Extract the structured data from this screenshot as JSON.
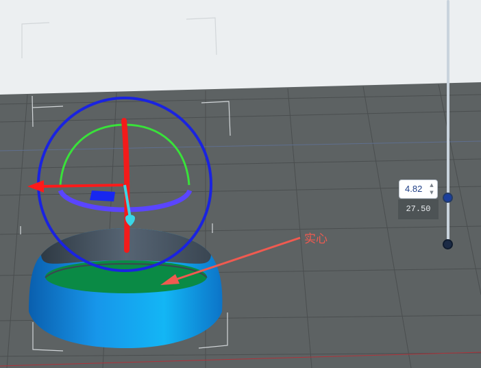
{
  "colors": {
    "background_top": "#eceff1",
    "floor": "#5d6263",
    "grid_line": "#4a4e4f",
    "blue_grid_line": "#5f6f8f",
    "red_axis_line": "#b0323a",
    "gizmo_ring": "#1a23e0",
    "rotate_y_arc": "#39e23a",
    "rotate_x_arc": "#5a45ff",
    "rotate_z_bar": "#f21b1b",
    "arrow_x": "#ff1a1a",
    "arrow_y": "#39d6e6",
    "center_square": "#1727f0",
    "model_side": "#1488e0",
    "model_top_surface": "#0a8a45",
    "model_inner_wall": "#3c4650",
    "bounding_box": "#d2d6d9",
    "annotation": "#f05a50",
    "slider_track": "#c9d3dd",
    "slider_handle_top": "#1b3f9c",
    "slider_handle_bottom": "#1b2a45",
    "total_box": "#4d5355"
  },
  "layer_slider": {
    "current_value": "4.82",
    "total_height": "27.50",
    "spin_up_icon": "chevron-up-icon",
    "spin_down_icon": "chevron-down-icon"
  },
  "annotation": {
    "label": "实心"
  }
}
